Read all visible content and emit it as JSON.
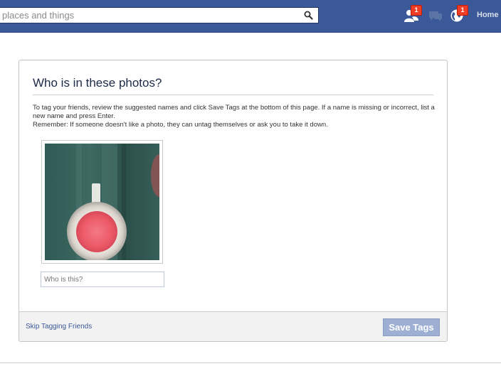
{
  "header": {
    "search_placeholder": "places and things",
    "search_icon": "magnifier-icon",
    "friend_requests": {
      "icon": "friends-icon",
      "count": "1"
    },
    "messages": {
      "icon": "messages-icon"
    },
    "notifications": {
      "icon": "globe-icon",
      "count": "1"
    },
    "home_label": "Home"
  },
  "dialog": {
    "title": "Who is in these photos?",
    "instruction_1": "To tag your friends, review the suggested names and click Save Tags at the bottom of this page. If a name is missing or incorrect, list a new name and press Enter.",
    "instruction_2": "Remember: If someone doesn't like a photo, they can untag themselves or ask you to take it down.",
    "tag_input_placeholder": "Who is this?",
    "skip_label": "Skip Tagging Friends",
    "save_label": "Save Tags"
  },
  "colors": {
    "brand_blue": "#3b5998",
    "badge_red": "#f03d25",
    "save_disabled": "#9db0d4"
  }
}
